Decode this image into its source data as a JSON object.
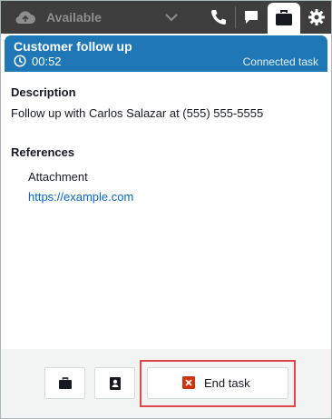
{
  "topbar": {
    "status_label": "Available",
    "icons": [
      "cloud-status-icon",
      "chevron-down-icon",
      "phone-icon",
      "chat-icon",
      "briefcase-icon",
      "gear-icon"
    ],
    "active_tab": "briefcase-icon"
  },
  "contact": {
    "title": "Customer follow up",
    "timer": "00:52",
    "state": "Connected task"
  },
  "description": {
    "heading": "Description",
    "text": "Follow up with Carlos Salazar at (555) 555-5555"
  },
  "references": {
    "heading": "References",
    "attachment_label": "Attachment",
    "link": "https://example.com"
  },
  "footer": {
    "end_task_label": "End task",
    "icons": [
      "briefcase-icon",
      "contact-card-icon",
      "close-icon"
    ]
  },
  "colors": {
    "topbar_bg": "#3e3e3e",
    "header_bg": "#1f77b6",
    "link": "#0b66c2",
    "highlight": "#e0474c",
    "end_icon": "#d13212"
  }
}
